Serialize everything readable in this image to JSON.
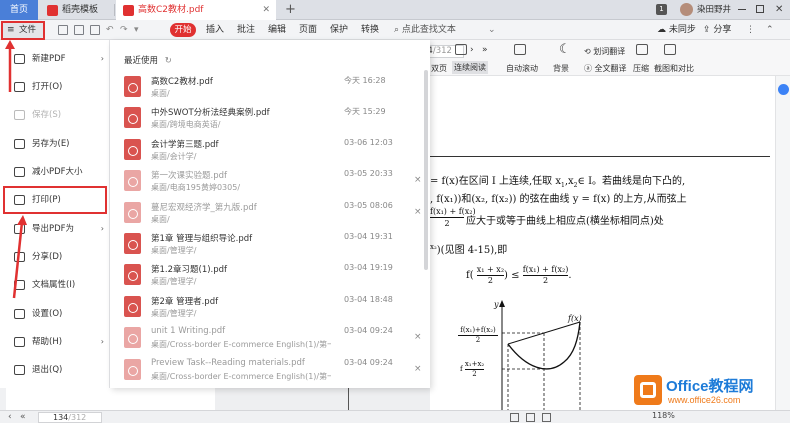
{
  "tabs": {
    "home": "首页",
    "template": "稻壳模板",
    "doc": "高数C2教材.pdf",
    "new_tab": "+",
    "badge": "1",
    "user": "染田野井"
  },
  "toolbar": {
    "file_menu": "文件",
    "start": "开始",
    "items": [
      "插入",
      "批注",
      "编辑",
      "页面",
      "保护",
      "转换"
    ],
    "search": "点此查找文本",
    "unsynced": "未同步",
    "share": "分享"
  },
  "ribbon": {
    "page_current": "34",
    "page_total": "/312",
    "two_page": "双页",
    "continuous": "连续阅读",
    "auto_scroll": "自动滚动",
    "background": "背景",
    "word_translate": "划词翻译",
    "full_translate": "全文翻译",
    "compress": "压缩",
    "screenshot_compare": "截图和对比"
  },
  "menu": {
    "items": [
      {
        "label": "新建PDF",
        "icon": "new-pdf-icon",
        "arrow": true,
        "disabled": false
      },
      {
        "label": "打开(O)",
        "icon": "folder-open-icon",
        "arrow": false,
        "disabled": false
      },
      {
        "label": "保存(S)",
        "icon": "save-icon",
        "arrow": false,
        "disabled": true
      },
      {
        "label": "另存为(E)",
        "icon": "save-as-icon",
        "arrow": false,
        "disabled": false
      },
      {
        "label": "减小PDF大小",
        "icon": "compress-icon",
        "arrow": false,
        "disabled": false
      },
      {
        "label": "打印(P)",
        "icon": "printer-icon",
        "arrow": false,
        "disabled": false
      },
      {
        "label": "导出PDF为",
        "icon": "export-icon",
        "arrow": true,
        "disabled": false
      },
      {
        "label": "分享(D)",
        "icon": "share-icon",
        "arrow": false,
        "disabled": false
      },
      {
        "label": "文档属性(I)",
        "icon": "document-properties-icon",
        "arrow": false,
        "disabled": false
      },
      {
        "label": "设置(O)",
        "icon": "gear-icon",
        "arrow": false,
        "disabled": false
      },
      {
        "label": "帮助(H)",
        "icon": "help-icon",
        "arrow": true,
        "disabled": false
      },
      {
        "label": "退出(Q)",
        "icon": "exit-icon",
        "arrow": false,
        "disabled": false
      }
    ]
  },
  "recent": {
    "title": "最近使用",
    "files": [
      {
        "name": "高数C2教材.pdf",
        "path": "桌面/",
        "time": "今天 16:28",
        "dim": false,
        "close": false
      },
      {
        "name": "中外SWOT分析法经典案例.pdf",
        "path": "桌面/跨境电商英语/",
        "time": "今天 15:29",
        "dim": false,
        "close": false
      },
      {
        "name": "会计学第三题.pdf",
        "path": "桌面/会计学/",
        "time": "03-06 12:03",
        "dim": false,
        "close": false
      },
      {
        "name": "第一次课实验题.pdf",
        "path": "桌面/电商195黄婷0305/",
        "time": "03-05 20:33",
        "dim": true,
        "close": true
      },
      {
        "name": "蔓尼宏观经济学_第九版.pdf",
        "path": "桌面/",
        "time": "03-05 08:06",
        "dim": true,
        "close": true
      },
      {
        "name": "第1章 管理与组织导论.pdf",
        "path": "桌面/管理学/",
        "time": "03-04 19:31",
        "dim": false,
        "close": false
      },
      {
        "name": "第1.2章习题(1).pdf",
        "path": "桌面/管理学/",
        "time": "03-04 19:19",
        "dim": false,
        "close": false
      },
      {
        "name": "第2章 管理者.pdf",
        "path": "桌面/管理学/",
        "time": "03-04 18:48",
        "dim": false,
        "close": false
      },
      {
        "name": "unit 1 Writing.pdf",
        "path": "桌面/Cross-border E-commerce English(1)/第一...",
        "time": "03-04 09:24",
        "dim": true,
        "close": true
      },
      {
        "name": "Preview Task--Reading materials.pdf",
        "path": "桌面/Cross-border E-commerce English(1)/第一...",
        "time": "03-04 09:24",
        "dim": true,
        "close": true
      }
    ]
  },
  "document": {
    "line1a": "= f(x)在区间 I 上连续,任取 x",
    "line1b": ",x",
    "line1c": "∈ I。若曲线是向下凸的,",
    "line2": ", f(x₁))和(x₂, f(x₂)) 的弦在曲线 y = f(x) 的上方,从而弦上",
    "line3": "应大于或等于曲线上相应点(横坐标相同点)处",
    "line4": ")(见图 4-15),即",
    "frac_num": "f(x₁) + f(x₂)",
    "frac_den": "2",
    "formula_left": "f(",
    "formula_rest": ") ≤",
    "formula_num": "f(x₁) + f(x₂)",
    "formula_den": "2",
    "x_over": "x₁ + x₂",
    "graph_fx": "f(x)",
    "graph_y": "y",
    "graph_label1_num": "f(x₁)+f(x₂)",
    "graph_label1_den": "2",
    "graph_label2": "f",
    "graph_label2_num": "x₁+x₂",
    "graph_label2_den": "2"
  },
  "status": {
    "page_current": "134",
    "page_total": "/312",
    "zoom": "118%"
  },
  "watermark": {
    "brand": "Office教程网",
    "url": "www.office26.com"
  },
  "colors": {
    "accent": "#e03131",
    "start_button": "#e03131",
    "watermark_orange": "#ef7a1a",
    "watermark_blue": "#1d7bd8"
  }
}
